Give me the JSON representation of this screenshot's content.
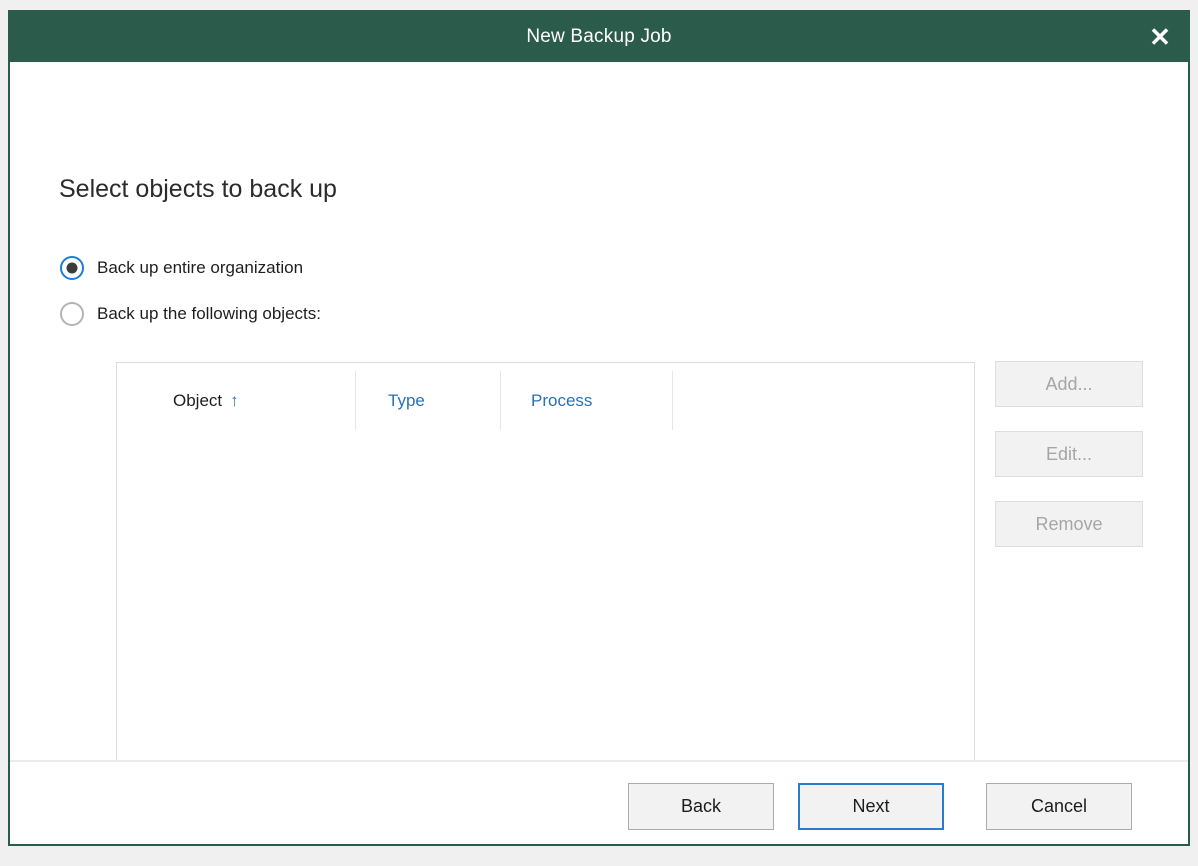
{
  "window": {
    "title": "New Backup Job",
    "close_icon": "close-icon",
    "close_glyph": "✕",
    "title_bar_color": "#2b5c4b",
    "border_color": "#2b5c4b"
  },
  "page": {
    "heading": "Select objects to back up"
  },
  "scope_options": [
    {
      "label": "Back up entire organization",
      "selected": true
    },
    {
      "label": "Back up the following objects:",
      "selected": false
    }
  ],
  "object_list": {
    "columns": [
      {
        "label": "Object",
        "sorted": true,
        "sort_icon": "sort-ascending-icon",
        "sort_glyph": "↑",
        "link": false
      },
      {
        "label": "Type",
        "sorted": false,
        "link": true
      },
      {
        "label": "Process",
        "sorted": false,
        "link": true
      },
      {
        "label": "",
        "sorted": false,
        "link": false
      }
    ],
    "rows": []
  },
  "side_buttons": [
    {
      "label": "Add...",
      "enabled": false
    },
    {
      "label": "Edit...",
      "enabled": false
    },
    {
      "label": "Remove",
      "enabled": false
    }
  ],
  "footer_buttons": [
    {
      "label": "Back",
      "default": false
    },
    {
      "label": "Next",
      "default": true
    },
    {
      "label": "Cancel",
      "default": false
    }
  ],
  "colors": {
    "accent_green": "#2b5c4b",
    "link_blue": "#2a70b8",
    "focus_blue": "#2a7ad0",
    "radio_selected_ring": "#1a7fd4",
    "disabled_text": "#a6a6a6"
  }
}
